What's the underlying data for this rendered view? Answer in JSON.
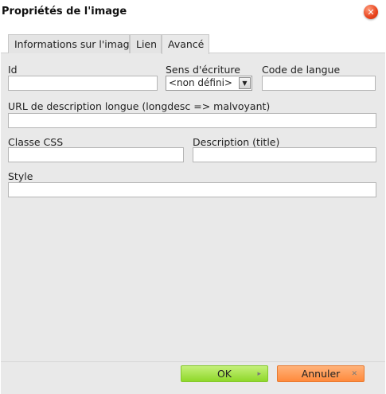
{
  "dialog": {
    "title": "Propriétés de l'image",
    "close_icon": "close-icon"
  },
  "tabs": [
    {
      "label": "Informations sur l'image"
    },
    {
      "label": "Lien"
    },
    {
      "label": "Avancé",
      "active": true
    }
  ],
  "fields": {
    "id": {
      "label": "Id",
      "value": ""
    },
    "direction": {
      "label": "Sens d'écriture",
      "value": "<non défini>"
    },
    "lang": {
      "label": "Code de langue",
      "value": ""
    },
    "longdesc": {
      "label": "URL de description longue (longdesc => malvoyant)",
      "value": ""
    },
    "css_class": {
      "label": "Classe CSS",
      "value": ""
    },
    "title": {
      "label": "Description (title)",
      "value": ""
    },
    "style": {
      "label": "Style",
      "value": ""
    }
  },
  "buttons": {
    "ok": "OK",
    "cancel": "Annuler"
  },
  "colors": {
    "ok_button": "#9be03a",
    "cancel_button": "#ff9a55",
    "close_button": "#e8431c",
    "panel_bg": "#e9e9e9"
  }
}
